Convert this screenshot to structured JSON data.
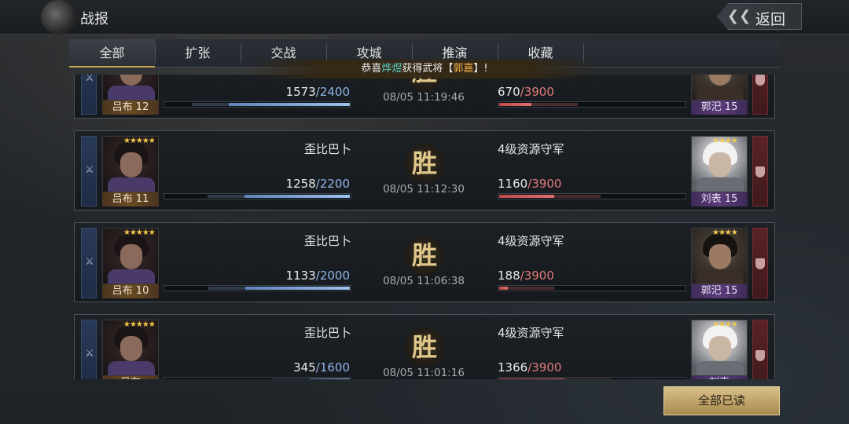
{
  "window": {
    "title": "战报",
    "back_label": "返回"
  },
  "tabs": [
    {
      "label": "全部",
      "active": true
    },
    {
      "label": "扩张"
    },
    {
      "label": "交战"
    },
    {
      "label": "攻城"
    },
    {
      "label": "推演"
    },
    {
      "label": "收藏"
    }
  ],
  "notice": {
    "prefix": "恭喜",
    "player": "烨煜",
    "middle": "获得武将【",
    "general": "郭嘉",
    "suffix": "】!"
  },
  "reports": [
    {
      "left": {
        "general": "吕布",
        "level": "12",
        "player": "",
        "troops": "1573",
        "max": "2400",
        "stars": ""
      },
      "result": "胜",
      "time": "08/05 11:19:46",
      "right": {
        "general": "郭汜",
        "level": "15",
        "player": "",
        "troops": "670",
        "max": "3900",
        "stars": ""
      }
    },
    {
      "left": {
        "general": "吕布",
        "level": "11",
        "player": "歪比巴卜",
        "troops": "1258",
        "max": "2200",
        "stars": "★★★★★"
      },
      "result": "胜",
      "time": "08/05 11:12:30",
      "right": {
        "general": "刘表",
        "level": "15",
        "player": "4级资源守军",
        "troops": "1160",
        "max": "3900",
        "stars": "★★★★"
      }
    },
    {
      "left": {
        "general": "吕布",
        "level": "10",
        "player": "歪比巴卜",
        "troops": "1133",
        "max": "2000",
        "stars": "★★★★★"
      },
      "result": "胜",
      "time": "08/05 11:06:38",
      "right": {
        "general": "郭汜",
        "level": "15",
        "player": "4级资源守军",
        "troops": "188",
        "max": "3900",
        "stars": "★★★★"
      }
    },
    {
      "left": {
        "general": "吕布",
        "level": "",
        "player": "歪比巴卜",
        "troops": "345",
        "max": "1600",
        "stars": "★★★★★"
      },
      "result": "胜",
      "time": "08/05 11:01:16",
      "right": {
        "general": "刘表",
        "level": "",
        "player": "4级资源守军",
        "troops": "1366",
        "max": "3900",
        "stars": "★★★★"
      }
    }
  ],
  "footer": {
    "read_all_label": "全部已读"
  },
  "colors": {
    "accent_gold": "#c7a35a",
    "attacker_blue": "#8fb4e6",
    "defender_red": "#e07a7a",
    "notice_player": "#5fd0c7",
    "notice_general": "#f0b04a"
  },
  "icons": {
    "logo": "emblem-icon",
    "back": "chevron-left-double-icon",
    "attacker": "sword-icon",
    "defender": "shield-icon",
    "result": "victory-badge-icon"
  }
}
